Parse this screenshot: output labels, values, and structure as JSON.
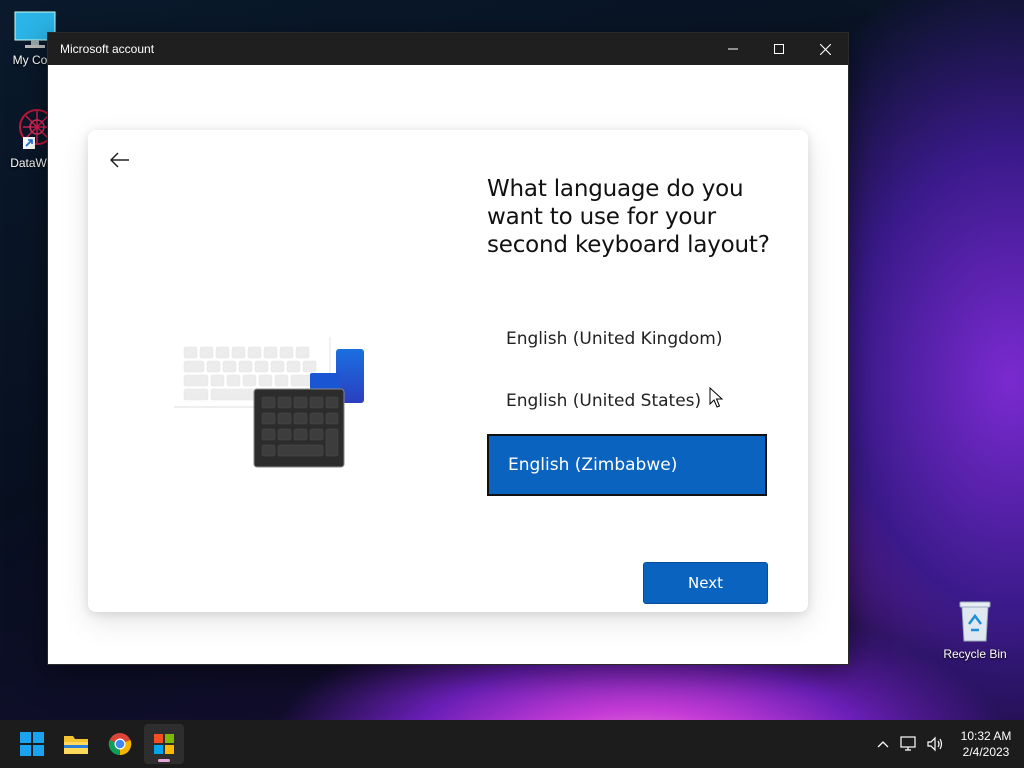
{
  "desktop": {
    "icons": [
      {
        "label": "My Com"
      },
      {
        "label": "DataWag"
      },
      {
        "label": "Recycle Bin"
      }
    ]
  },
  "window": {
    "title": "Microsoft account"
  },
  "setup": {
    "heading": "What language do you want to use for your second keyboard layout?",
    "options": [
      {
        "label": "English (United Kingdom)",
        "selected": false
      },
      {
        "label": "English (United States)",
        "selected": false
      },
      {
        "label": "English (Zimbabwe)",
        "selected": true
      }
    ],
    "next_label": "Next"
  },
  "taskbar": {
    "apps": [
      "start-icon",
      "file-explorer-icon",
      "chrome-icon",
      "microsoft-store-icon"
    ]
  },
  "tray": {
    "time": "10:32 AM",
    "date": "2/4/2023"
  },
  "colors": {
    "accent": "#0a64bf",
    "titlebar": "#1f1f1f",
    "taskbar": "#1c1c1c"
  }
}
